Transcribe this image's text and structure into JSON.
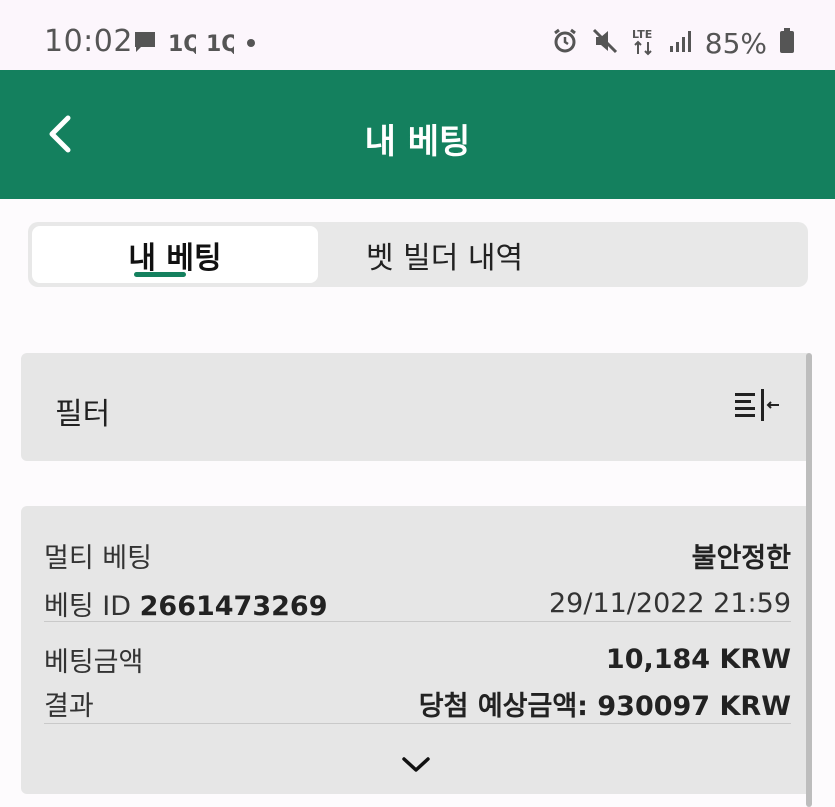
{
  "status_bar": {
    "time": "10:02",
    "left_icons": [
      "chat-icon",
      "1q-icon",
      "1q-icon",
      "dot-icon"
    ],
    "right_icons": [
      "alarm-icon",
      "mute-icon",
      "lte-icon",
      "signal-icon"
    ],
    "battery_percent": "85%",
    "lte_label": "LTE"
  },
  "app_bar": {
    "title": "내 베팅",
    "color": "#14805e"
  },
  "tabs": {
    "active_label": "내 베팅",
    "inactive_label": "벳 빌더 내역"
  },
  "filter": {
    "label": "필터"
  },
  "bet_card": {
    "type_label": "멀티 베팅",
    "status": "불안정한",
    "bet_id_label": "베팅 ID",
    "bet_id": "2661473269",
    "datetime": "29/11/2022 21:59",
    "stake_label": "베팅금액",
    "stake_value": "10,184 KRW",
    "result_label": "결과",
    "result_value": "당첨 예상금액: 930097 KRW"
  }
}
